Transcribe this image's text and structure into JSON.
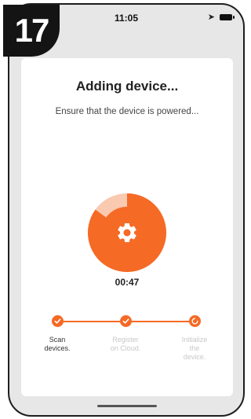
{
  "step_badge": "17",
  "status_bar": {
    "time": "11:05"
  },
  "header": {
    "title": "Adding device...",
    "subtitle": "Ensure that the device is powered..."
  },
  "progress": {
    "timer": "00:47",
    "elapsed_fraction": 0.85
  },
  "steps": [
    {
      "label": "Scan\ndevices.",
      "state": "done"
    },
    {
      "label": "Register\non Cloud.",
      "state": "done"
    },
    {
      "label": "Initialize\nthe\ndevice.",
      "state": "in-progress"
    }
  ],
  "colors": {
    "accent": "#f56a25",
    "accent_light": "#f9c9b0",
    "inactive_text": "#c8c8c8",
    "background": "#e7e7e7"
  },
  "icons": {
    "gear": "gear-icon",
    "check": "check-icon",
    "loading": "loading-icon",
    "location": "location-arrow-icon",
    "battery": "battery-icon"
  }
}
